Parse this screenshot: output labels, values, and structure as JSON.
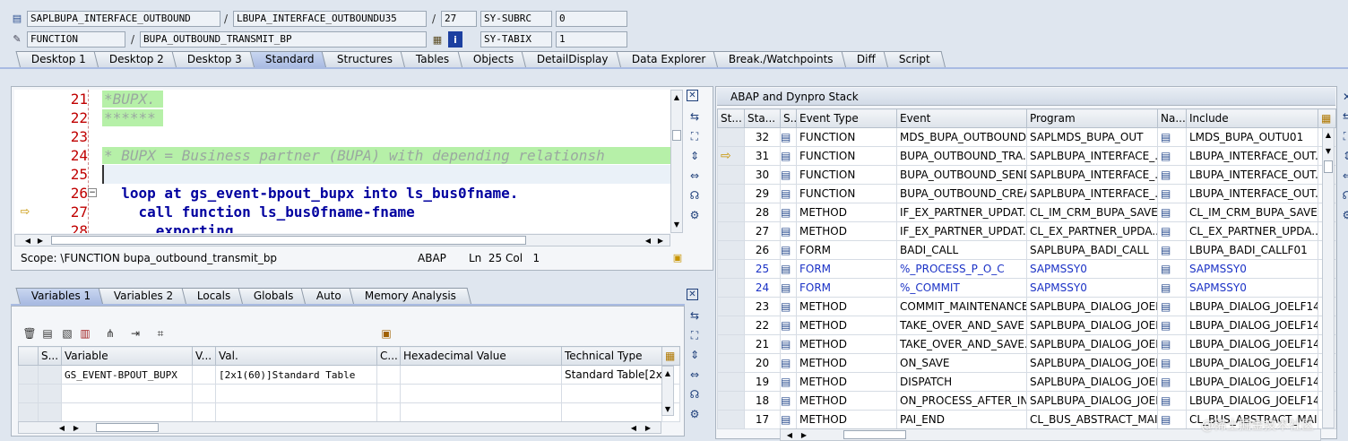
{
  "header": {
    "row1": {
      "program": "SAPLBUPA_INTERFACE_OUTBOUND",
      "include": "LBUPA_INTERFACE_OUTBOUNDU35",
      "line": "27",
      "sysfield": "SY-SUBRC",
      "sysvalue": "0"
    },
    "row2": {
      "type": "FUNCTION",
      "name": "BUPA_OUTBOUND_TRANSMIT_BP",
      "sysfield": "SY-TABIX",
      "sysvalue": "1"
    }
  },
  "tabs": [
    "Desktop 1",
    "Desktop 2",
    "Desktop 3",
    "Standard",
    "Structures",
    "Tables",
    "Objects",
    "DetailDisplay",
    "Data Explorer",
    "Break./Watchpoints",
    "Diff",
    "Script"
  ],
  "code": [
    {
      "num": "21",
      "text": "*BUPX.",
      "style": "cmt"
    },
    {
      "num": "22",
      "text": "******",
      "style": "cmt"
    },
    {
      "num": "23",
      "text": "",
      "style": "plain"
    },
    {
      "num": "24",
      "text": "* BUPX = Business partner (BUPA) with depending relationsh",
      "style": "cmt"
    },
    {
      "num": "25",
      "text": "",
      "style": "plain"
    },
    {
      "num": "26",
      "text": "  loop at gs_event-bpout_bupx into ls_bus0fname.",
      "style": "code"
    },
    {
      "num": "27",
      "text": "    call function ls_bus0fname-fname",
      "style": "code"
    },
    {
      "num": "28",
      "text": "      exporting",
      "style": "code"
    }
  ],
  "status": {
    "scope": "Scope: \\FUNCTION bupa_outbound_transmit_bp",
    "lang": "ABAP",
    "pos": "Ln  25 Col   1"
  },
  "var_tabs": [
    "Variables 1",
    "Variables 2",
    "Locals",
    "Globals",
    "Auto",
    "Memory Analysis"
  ],
  "variables": {
    "columns": [
      "S...",
      "Variable",
      "V...",
      "Val.",
      "C...",
      "Hexadecimal Value",
      "Technical Type"
    ],
    "rows": [
      {
        "variable": "GS_EVENT-BPOUT_BUPX",
        "value": "[2x1(60)]Standard Table",
        "type": "Standard Table[2x..."
      }
    ]
  },
  "stack": {
    "title": "ABAP and Dynpro Stack",
    "columns": [
      "St...",
      "Sta...",
      "S...",
      "Event Type",
      "Event",
      "Program",
      "Na...",
      "Include"
    ],
    "rows": [
      {
        "level": "32",
        "etype": "FUNCTION",
        "event": "MDS_BUPA_OUTBOUND",
        "program": "SAPLMDS_BUPA_OUT",
        "include": "LMDS_BUPA_OUTU01",
        "cur": false,
        "link": false
      },
      {
        "level": "31",
        "etype": "FUNCTION",
        "event": "BUPA_OUTBOUND_TRA...",
        "program": "SAPLBUPA_INTERFACE_...",
        "include": "LBUPA_INTERFACE_OUT...",
        "cur": true,
        "link": false
      },
      {
        "level": "30",
        "etype": "FUNCTION",
        "event": "BUPA_OUTBOUND_SEND",
        "program": "SAPLBUPA_INTERFACE_...",
        "include": "LBUPA_INTERFACE_OUT...",
        "cur": false,
        "link": false
      },
      {
        "level": "29",
        "etype": "FUNCTION",
        "event": "BUPA_OUTBOUND_CREA...",
        "program": "SAPLBUPA_INTERFACE_...",
        "include": "LBUPA_INTERFACE_OUT...",
        "cur": false,
        "link": false
      },
      {
        "level": "28",
        "etype": "METHOD",
        "event": "IF_EX_PARTNER_UPDAT...",
        "program": "CL_IM_CRM_BUPA_SAVE...",
        "include": "CL_IM_CRM_BUPA_SAVE...",
        "cur": false,
        "link": false
      },
      {
        "level": "27",
        "etype": "METHOD",
        "event": "IF_EX_PARTNER_UPDAT...",
        "program": "CL_EX_PARTNER_UPDA...",
        "include": "CL_EX_PARTNER_UPDA...",
        "cur": false,
        "link": false
      },
      {
        "level": "26",
        "etype": "FORM",
        "event": "BADI_CALL",
        "program": "SAPLBUPA_BADI_CALL",
        "include": "LBUPA_BADI_CALLF01",
        "cur": false,
        "link": false
      },
      {
        "level": "25",
        "etype": "FORM",
        "event": "%_PROCESS_P_O_C",
        "program": "SAPMSSY0",
        "include": "SAPMSSY0",
        "cur": false,
        "link": true
      },
      {
        "level": "24",
        "etype": "FORM",
        "event": "%_COMMIT",
        "program": "SAPMSSY0",
        "include": "SAPMSSY0",
        "cur": false,
        "link": true
      },
      {
        "level": "23",
        "etype": "METHOD",
        "event": "COMMIT_MAINTENANCES",
        "program": "SAPLBUPA_DIALOG_JOEL",
        "include": "LBUPA_DIALOG_JOELF14",
        "cur": false,
        "link": false
      },
      {
        "level": "22",
        "etype": "METHOD",
        "event": "TAKE_OVER_AND_SAVE",
        "program": "SAPLBUPA_DIALOG_JOEL",
        "include": "LBUPA_DIALOG_JOELF14",
        "cur": false,
        "link": false
      },
      {
        "level": "21",
        "etype": "METHOD",
        "event": "TAKE_OVER_AND_SAVE...",
        "program": "SAPLBUPA_DIALOG_JOEL",
        "include": "LBUPA_DIALOG_JOELF14",
        "cur": false,
        "link": false
      },
      {
        "level": "20",
        "etype": "METHOD",
        "event": "ON_SAVE",
        "program": "SAPLBUPA_DIALOG_JOEL",
        "include": "LBUPA_DIALOG_JOELF14",
        "cur": false,
        "link": false
      },
      {
        "level": "19",
        "etype": "METHOD",
        "event": "DISPATCH",
        "program": "SAPLBUPA_DIALOG_JOEL",
        "include": "LBUPA_DIALOG_JOELF14",
        "cur": false,
        "link": false
      },
      {
        "level": "18",
        "etype": "METHOD",
        "event": "ON_PROCESS_AFTER_IN...",
        "program": "SAPLBUPA_DIALOG_JOEL",
        "include": "LBUPA_DIALOG_JOELF14",
        "cur": false,
        "link": false
      },
      {
        "level": "17",
        "etype": "METHOD",
        "event": "PAI_END",
        "program": "CL_BUS_ABSTRACT_MAI...",
        "include": "CL_BUS_ABSTRACT_MAI...",
        "cur": false,
        "link": false
      }
    ]
  },
  "watermark": "@稀土掘金技术社区"
}
